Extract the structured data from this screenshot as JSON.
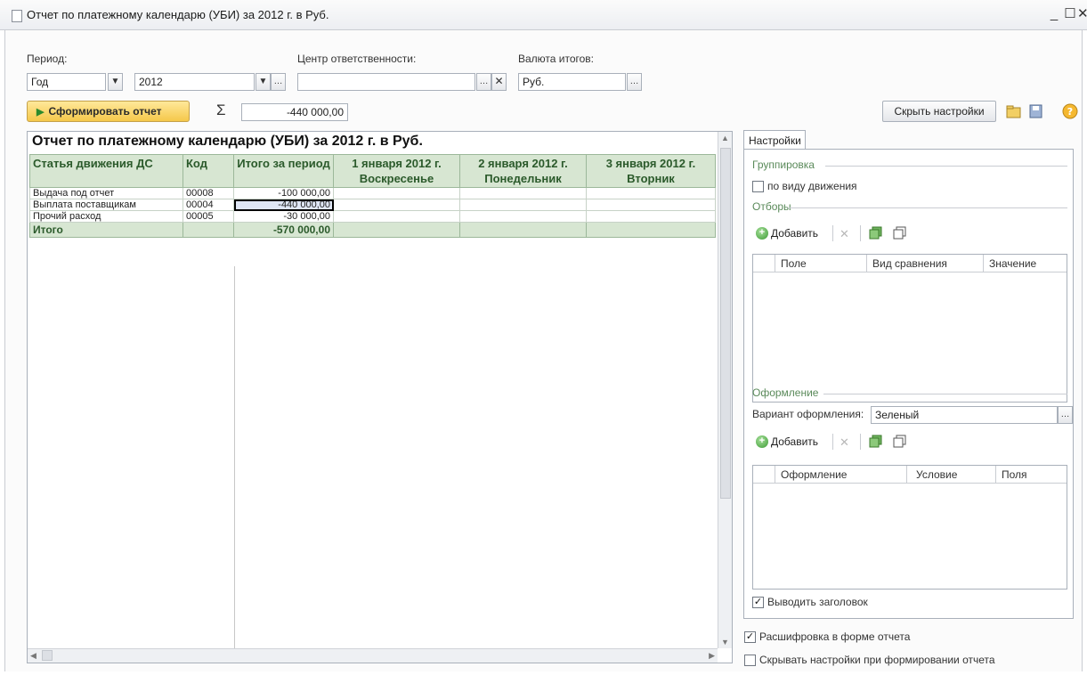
{
  "window": {
    "title": "Отчет по платежному календарю (УБИ) за 2012 г. в Руб."
  },
  "filters": {
    "period_label": "Период:",
    "period_type": "Год",
    "period_year": "2012",
    "center_label": "Центр ответственности:",
    "center_value": "",
    "currency_label": "Валюта итогов:",
    "currency_value": "Руб."
  },
  "toolbar": {
    "generate_label": "Сформировать отчет",
    "sum_value": "-440 000,00",
    "hide_settings_label": "Скрыть настройки"
  },
  "report": {
    "title": "Отчет по платежному календарю (УБИ)  за 2012 г. в Руб.",
    "headers": [
      "Статья движения ДС",
      "Код",
      "Итого за период",
      "1 января 2012 г. Воскресенье",
      "2 января 2012 г. Понедельник",
      "3 января 2012 г. Вторник"
    ],
    "rows": [
      {
        "name": "Выдача под отчет",
        "code": "00008",
        "total": "-100 000,00"
      },
      {
        "name": "Выплата поставщикам",
        "code": "00004",
        "total": "-440 000,00"
      },
      {
        "name": "Прочий расход",
        "code": "00005",
        "total": "-30 000,00"
      }
    ],
    "total_row": {
      "name": "Итого",
      "total": "-570 000,00"
    }
  },
  "settings": {
    "tab_label": "Настройки",
    "grouping_label": "Группировка",
    "group_by_movement": "по виду движения",
    "filters_label": "Отборы",
    "add_label": "Добавить",
    "filter_columns": [
      "Поле",
      "Вид сравнения",
      "Значение"
    ],
    "design_label": "Оформление",
    "design_variant_label": "Вариант оформления:",
    "design_variant_value": "Зеленый",
    "design_columns": [
      "Оформление",
      "Условие",
      "Поля"
    ],
    "show_title_label": "Выводить заголовок",
    "show_title_checked": true
  },
  "bottom": {
    "drilldown_label": "Расшифровка в форме отчета",
    "drilldown_checked": true,
    "hide_on_generate_label": "Скрывать настройки при формировании отчета",
    "hide_on_generate_checked": false
  }
}
